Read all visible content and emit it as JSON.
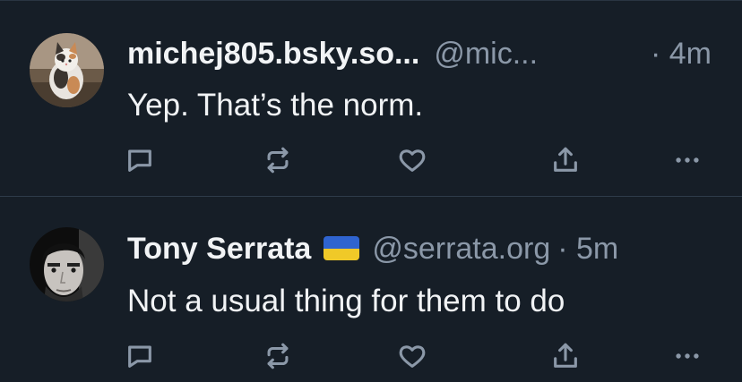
{
  "posts": [
    {
      "display_name": "michej805.bsky.so...",
      "handle": "@mic...",
      "time": "· 4m",
      "text": "Yep. That’s the norm.",
      "avatar_icon": "cat-photo-avatar",
      "has_flag": false
    },
    {
      "display_name": "Tony Serrata",
      "flag_icon": "ukraine-flag-emoji",
      "handle": "@serrata.org",
      "time": "· 5m",
      "text": "Not a usual thing for them to do",
      "avatar_icon": "man-photo-avatar",
      "has_flag": true
    }
  ],
  "action_icons": [
    "reply-icon",
    "repost-icon",
    "like-icon",
    "share-icon",
    "more-icon"
  ],
  "colors": {
    "background": "#161e27",
    "text": "#f1f3f5",
    "muted": "#8b98a8",
    "icon": "#8b98a8",
    "divider": "#2e3b4a"
  }
}
